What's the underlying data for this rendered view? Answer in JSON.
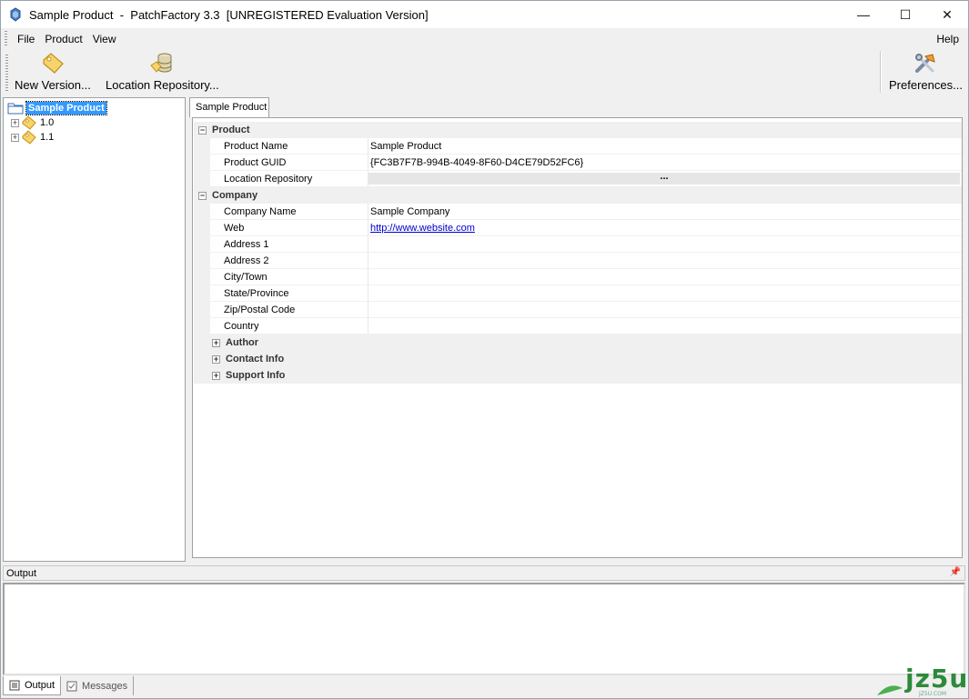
{
  "window": {
    "title": "Sample Product  -  PatchFactory 3.3  [UNREGISTERED Evaluation Version]",
    "minimize": "—",
    "maximize": "☐",
    "close": "✕"
  },
  "menu": {
    "file": "File",
    "product": "Product",
    "view": "View",
    "help": "Help"
  },
  "toolbar": {
    "new_version": "New Version...",
    "location_repository": "Location Repository...",
    "preferences": "Preferences..."
  },
  "tree": {
    "root": "Sample Product",
    "children": [
      "1.0",
      "1.1"
    ]
  },
  "tabs": {
    "active": "Sample Product"
  },
  "properties": {
    "product": {
      "header": "Product",
      "rows": [
        {
          "name": "Product Name",
          "value": "Sample Product"
        },
        {
          "name": "Product GUID",
          "value": "{FC3B7F7B-994B-4049-8F60-D4CE79D52FC6}"
        },
        {
          "name": "Location Repository",
          "value": "..."
        }
      ]
    },
    "company": {
      "header": "Company",
      "rows": [
        {
          "name": "Company Name",
          "value": "Sample Company"
        },
        {
          "name": "Web",
          "value": "http://www.website.com"
        },
        {
          "name": "Address 1",
          "value": ""
        },
        {
          "name": "Address 2",
          "value": ""
        },
        {
          "name": "City/Town",
          "value": ""
        },
        {
          "name": "State/Province",
          "value": ""
        },
        {
          "name": "Zip/Postal Code",
          "value": ""
        },
        {
          "name": "Country",
          "value": ""
        }
      ],
      "subsections": [
        "Author",
        "Contact Info",
        "Support Info"
      ]
    }
  },
  "output": {
    "header": "Output",
    "tabs": [
      "Output",
      "Messages"
    ]
  },
  "watermark": {
    "text": "jz5u",
    "sub": "JZ5U.COM"
  },
  "icons": {
    "app": "patchfactory-app-icon",
    "new_version": "tag-icon",
    "location_repository": "database-icon",
    "preferences": "tools-icon"
  }
}
